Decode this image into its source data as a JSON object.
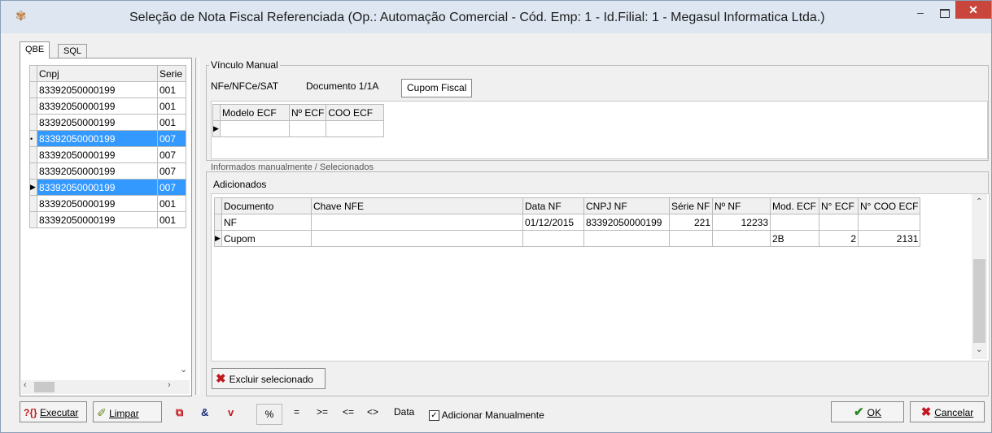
{
  "window": {
    "title": "Seleção de Nota Fiscal Referenciada (Op.: Automação Comercial - Cód. Emp: 1 - Id.Filial: 1 - Megasul Informatica Ltda.)"
  },
  "left_tabs": [
    "QBE",
    "SQL"
  ],
  "left_grid": {
    "headers": [
      "Cnpj",
      "Serie"
    ],
    "rows": [
      [
        "83392050000199",
        "001"
      ],
      [
        "83392050000199",
        "001"
      ],
      [
        "83392050000199",
        "001"
      ],
      [
        "83392050000199",
        "007"
      ],
      [
        "83392050000199",
        "007"
      ],
      [
        "83392050000199",
        "007"
      ],
      [
        "83392050000199",
        "007"
      ],
      [
        "83392050000199",
        "001"
      ],
      [
        "83392050000199",
        "001"
      ]
    ]
  },
  "manual": {
    "legend": "Vínculo Manual",
    "tabs": [
      "NFe/NFCe/SAT",
      "Documento 1/1A",
      "Cupom Fiscal"
    ],
    "grid_headers": [
      "Modelo ECF",
      "Nº ECF",
      "COO ECF"
    ]
  },
  "info_legend": "Informados manualmente / Selecionados",
  "added": {
    "legend": "Adicionados",
    "headers": [
      "Documento",
      "Chave NFE",
      "Data NF",
      "CNPJ NF",
      "Série NF",
      "Nº NF",
      "Mod. ECF",
      "N° ECF",
      "N° COO ECF"
    ],
    "rows": [
      [
        "NF",
        "",
        "01/12/2015",
        "83392050000199",
        "221",
        "12233",
        "",
        "",
        ""
      ],
      [
        "Cupom",
        "",
        "",
        "",
        "",
        "",
        "2B",
        "2",
        "2131"
      ]
    ]
  },
  "buttons": {
    "excluir": "Excluir selecionado",
    "executar": "Executar",
    "limpar": "Limpar",
    "ok": "OK",
    "cancelar": "Cancelar"
  },
  "toolbar": {
    "ops": [
      "%",
      "=",
      ">=",
      "<=",
      "<>",
      "Data"
    ],
    "checkbox_label": "Adicionar Manualmente",
    "checkbox_checked": true
  }
}
